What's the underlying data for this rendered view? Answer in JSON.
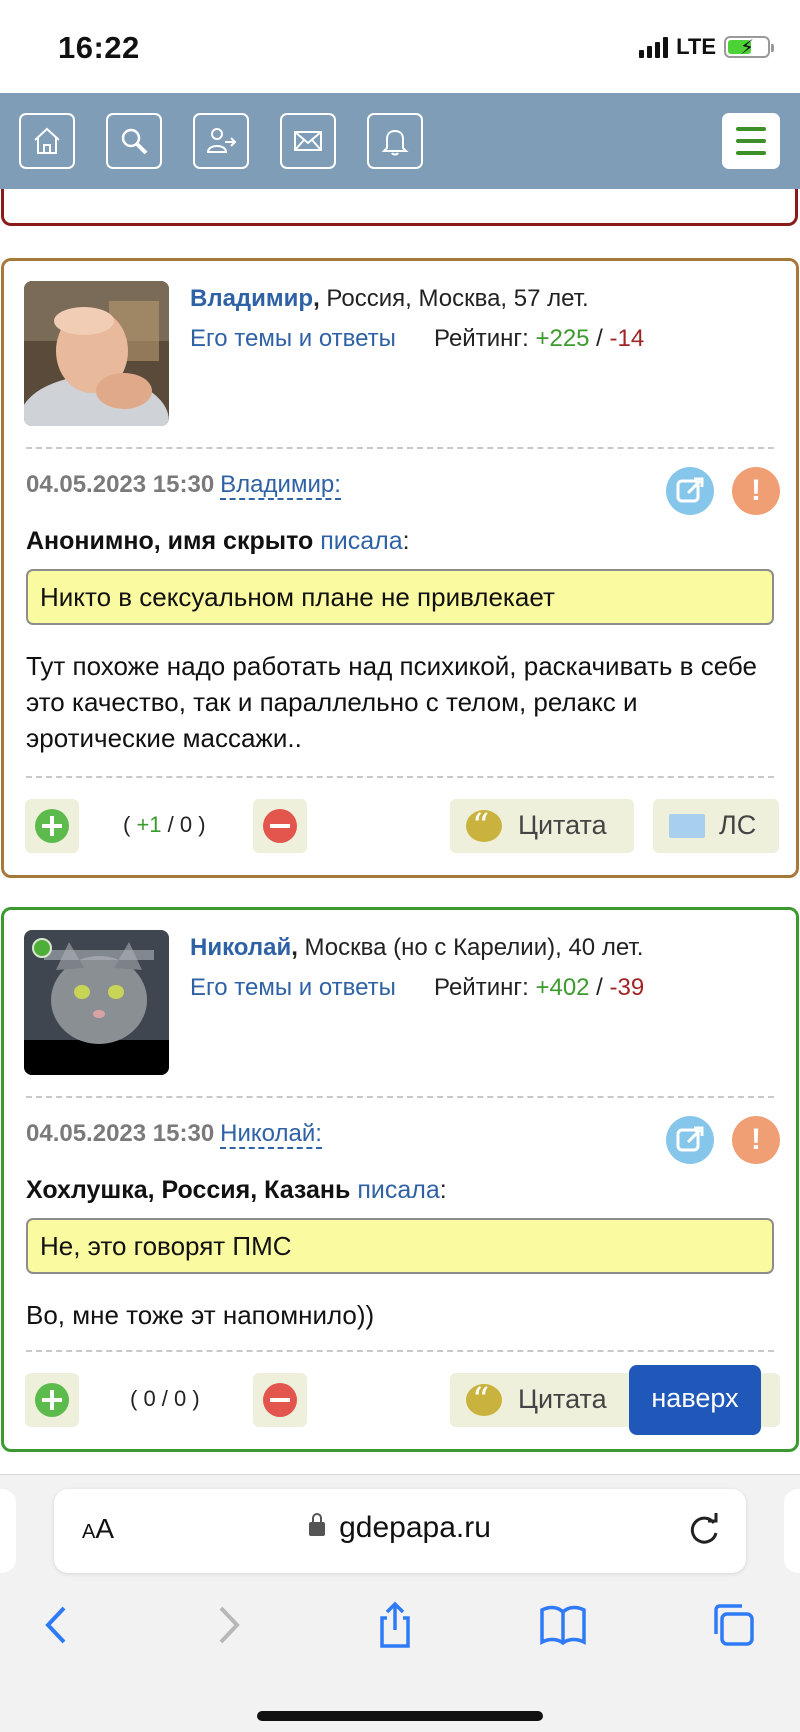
{
  "status_bar": {
    "time": "16:22",
    "network": "LTE"
  },
  "topnav": {
    "icons": [
      "home-icon",
      "search-icon",
      "login-icon",
      "mail-icon",
      "bell-icon",
      "menu-icon"
    ],
    "accent": "#7f9db7"
  },
  "posts": [
    {
      "author": "Владимир",
      "location": " Россия, Москва, 57 лет.",
      "themes_link": "Его темы и ответы",
      "rating_label": "Рейтинг: ",
      "rating_plus": "+225",
      "rating_sep": " / ",
      "rating_minus": "-14",
      "date": "04.05.2023 15:30",
      "post_author": "Владимир:",
      "quoted_name": "Анонимно, имя скрыто",
      "wrote": "писала",
      "quote": "Никто в сексуальном плане не привлекает",
      "text": "Тут похоже надо работать над психикой, раскачивать в себе это качество, так и параллельно с телом, релакс и эротические массажи..",
      "votes_open": "( ",
      "votes_plus": "+1",
      "votes_rest": " / 0 )",
      "quote_button": "Цитата",
      "pm_button": "ЛС",
      "border_color": "#a5793a"
    },
    {
      "author": "Николай",
      "location": " Москва (но с Карелии), 40 лет.",
      "themes_link": "Его темы и ответы",
      "rating_label": "Рейтинг: ",
      "rating_plus": "+402",
      "rating_sep": " / ",
      "rating_minus": "-39",
      "date": "04.05.2023 15:30",
      "post_author": "Николай:",
      "quoted_name": "Хохлушка, Россия, Казань",
      "wrote": "писала",
      "quote": "Не, это говорят ПМС",
      "text": "Во, мне тоже эт напомнило))",
      "votes": "( 0 / 0 )",
      "quote_button": "Цитата",
      "border_color": "#3a9a30"
    }
  ],
  "scroll_top_button": "наверх",
  "browser": {
    "aa_small": "A",
    "aa_large": "A",
    "url": "gdepapa.ru"
  }
}
